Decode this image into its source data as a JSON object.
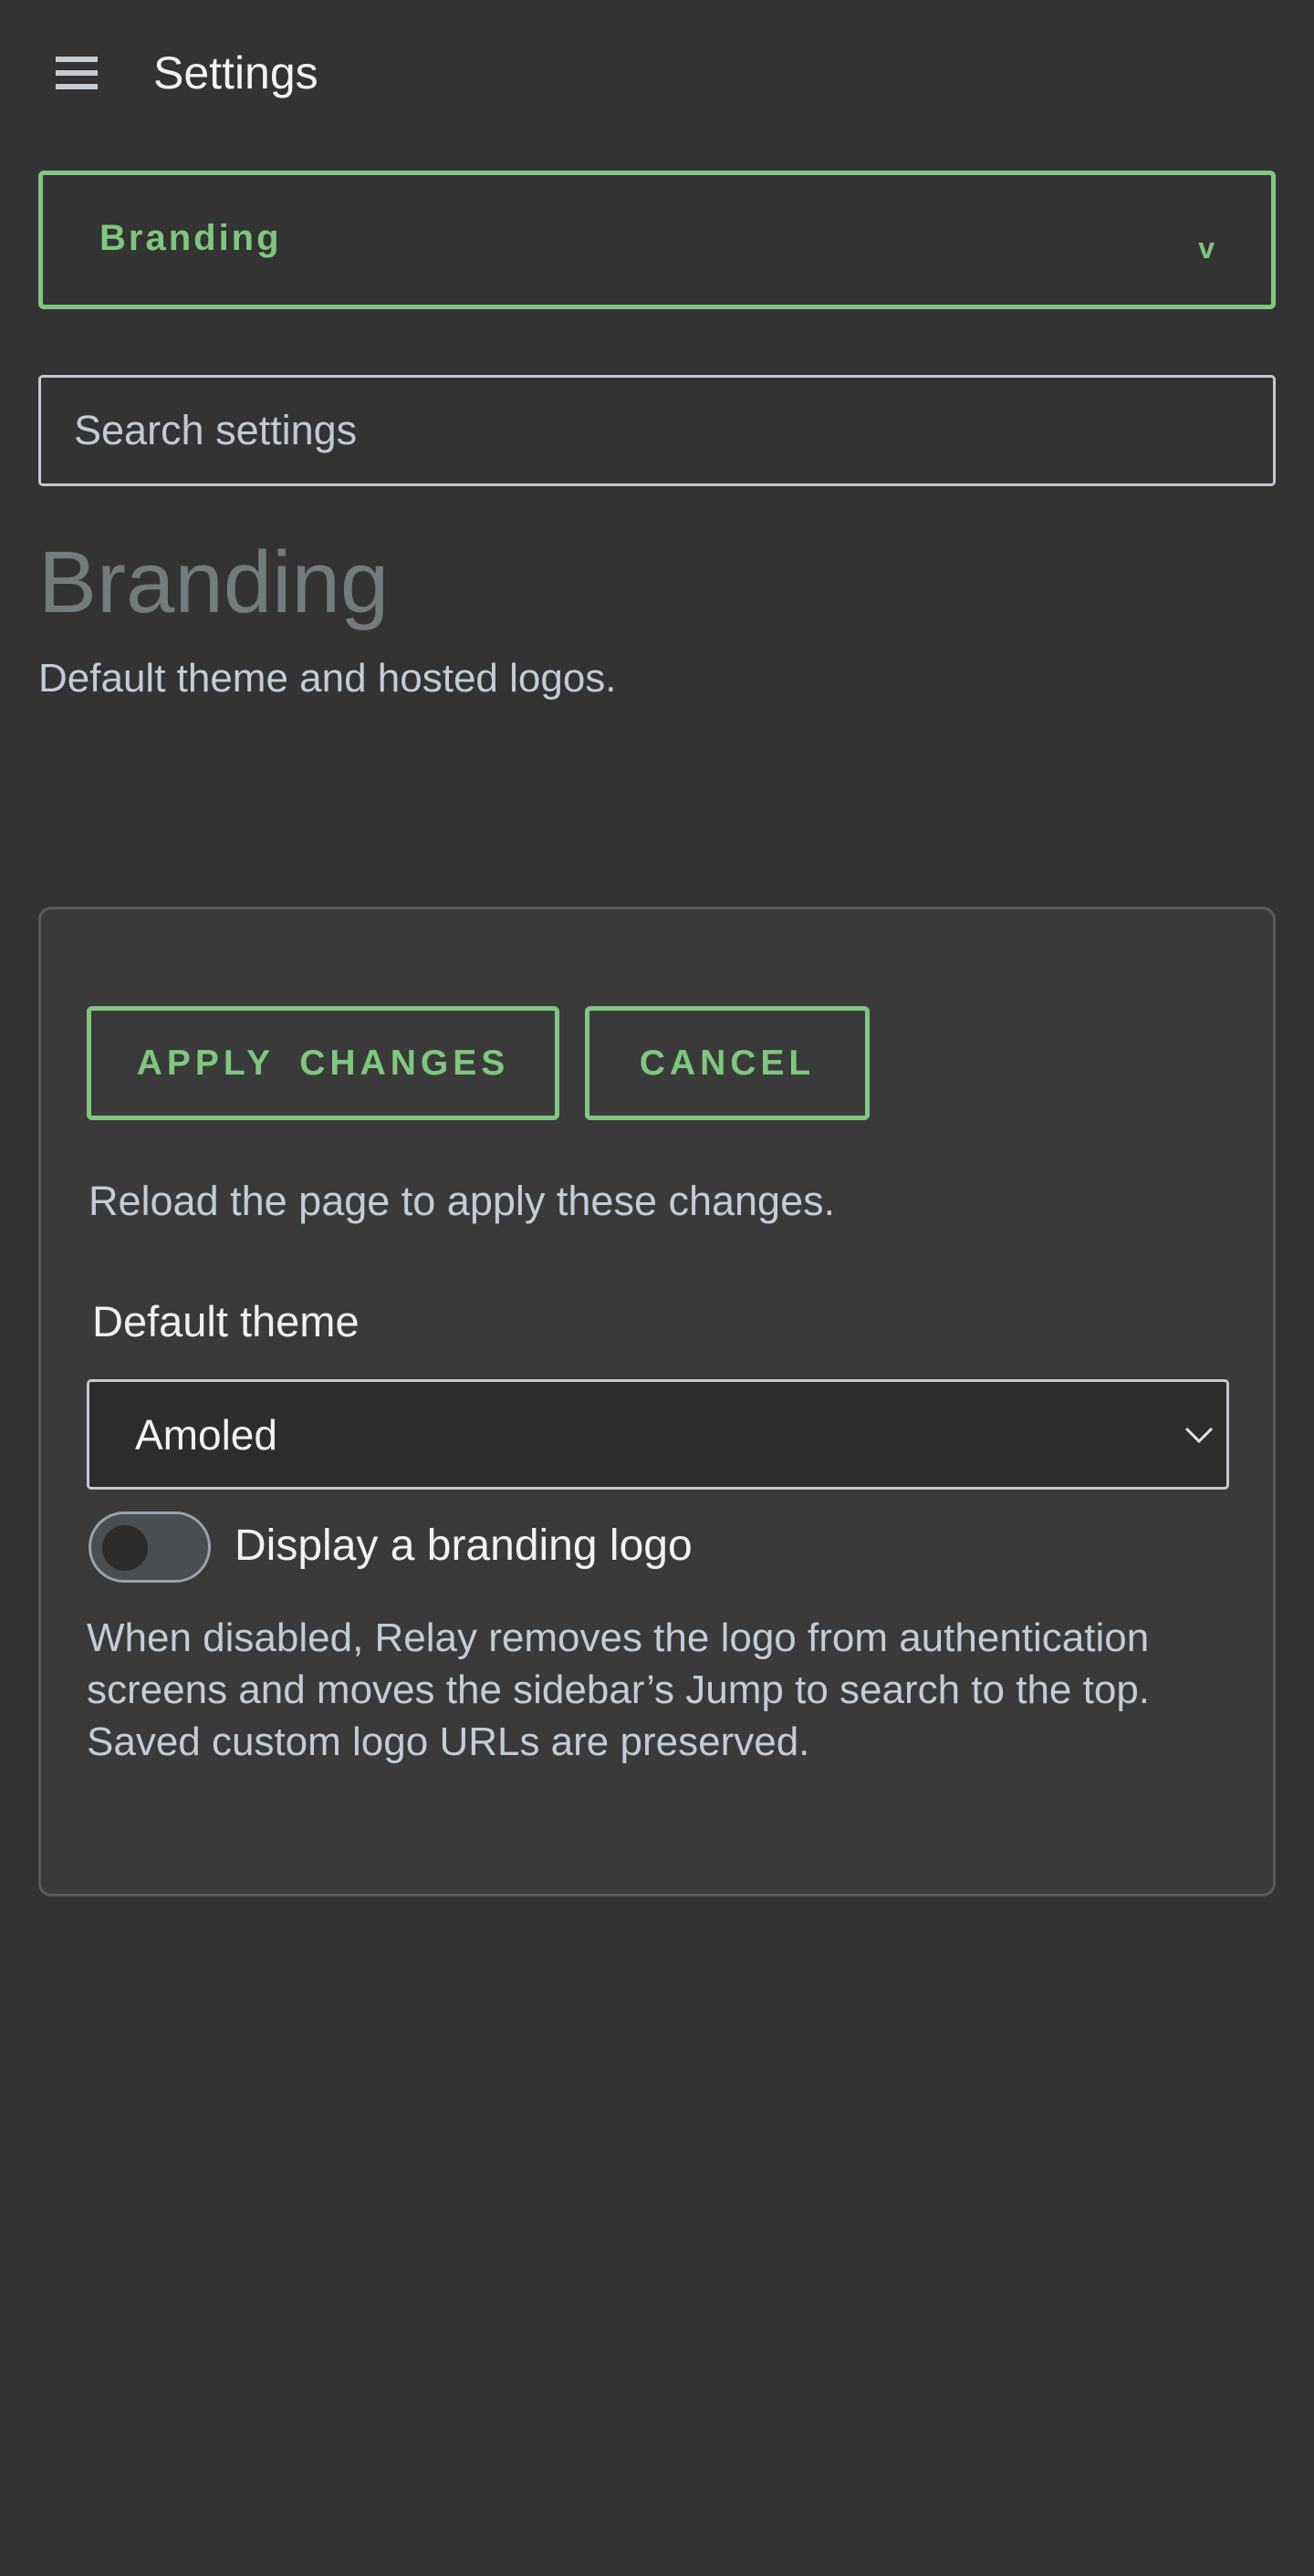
{
  "header": {
    "menu_icon": "hamburger-menu-icon",
    "title": "Settings"
  },
  "section_picker": {
    "selected": "Branding",
    "chevron": "v"
  },
  "search": {
    "placeholder": "Search settings",
    "value": ""
  },
  "page": {
    "title": "Branding",
    "description": "Default theme and hosted logos."
  },
  "card": {
    "apply_label": "APPLY  CHANGES",
    "cancel_label": "CANCEL",
    "reload_note": "Reload the page to apply these changes.",
    "theme": {
      "label": "Default theme",
      "selected": "Amoled",
      "caret_icon": "chevron-down-icon"
    },
    "logo_toggle": {
      "label": "Display a branding logo",
      "enabled": false
    },
    "help": "When disabled, Relay removes the logo from authentication screens and moves the sidebar’s Jump to search to the top. Saved custom logo URLs are preserved."
  },
  "colors": {
    "background": "#333333",
    "card_background": "#3a3a3a",
    "accent": "#7fc77f",
    "heading_muted": "#737b7d",
    "secondary_text": "#c4ccd6"
  }
}
